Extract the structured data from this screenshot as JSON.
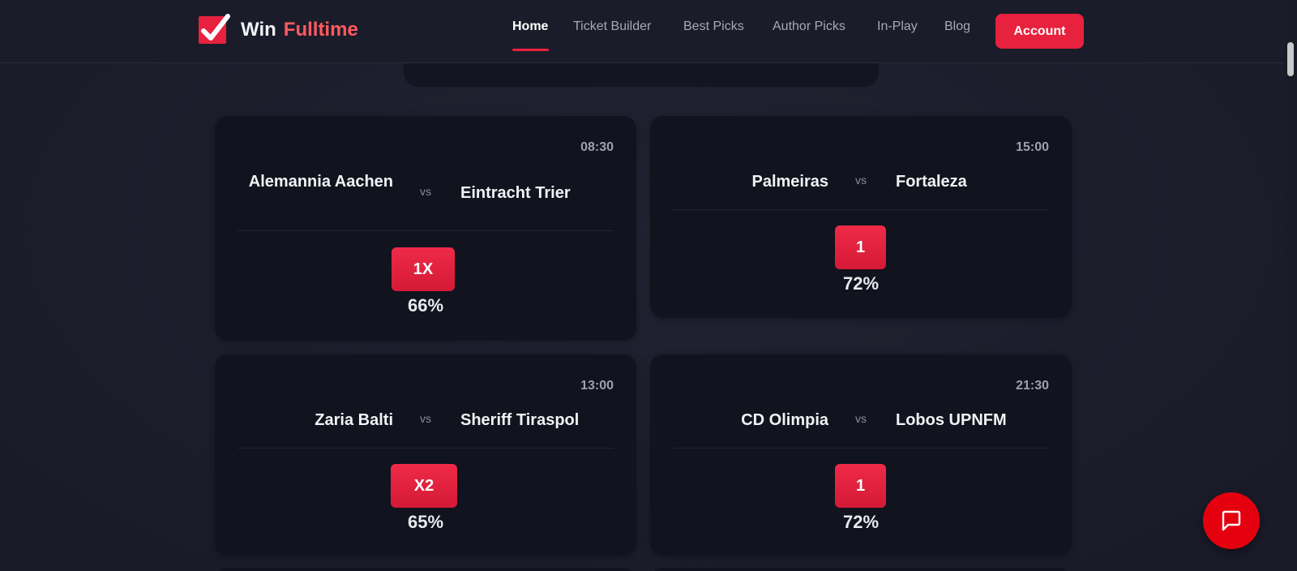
{
  "brand": {
    "word1": "Win",
    "word2": "Fulltime"
  },
  "nav": {
    "items": [
      {
        "label": "Home",
        "active": true
      },
      {
        "label": "Ticket Builder",
        "active": false
      },
      {
        "label": "Best Picks",
        "active": false
      },
      {
        "label": "Author Picks",
        "active": false
      },
      {
        "label": "In-Play",
        "active": false
      },
      {
        "label": "Blog",
        "active": false
      }
    ],
    "account_label": "Account"
  },
  "matches": [
    {
      "time": "08:30",
      "home": "Alemannia Aachen",
      "away": "Eintracht Trier",
      "vs": "vs",
      "pick": "1X",
      "probability": "66%"
    },
    {
      "time": "15:00",
      "home": "Palmeiras",
      "away": "Fortaleza",
      "vs": "vs",
      "pick": "1",
      "probability": "72%"
    },
    {
      "time": "13:00",
      "home": "Zaria Balti",
      "away": "Sheriff Tiraspol",
      "vs": "vs",
      "pick": "X2",
      "probability": "65%"
    },
    {
      "time": "21:30",
      "home": "CD Olimpia",
      "away": "Lobos UPNFM",
      "vs": "vs",
      "pick": "1",
      "probability": "72%"
    }
  ],
  "colors": {
    "accent": "#e8213f",
    "accent_text": "#ff5a5f",
    "background": "#1e1f2e",
    "card": "#11131e",
    "chat_button": "#e5000f"
  },
  "icons": {
    "logo": "checkmark-icon",
    "chat": "chat-bubble-icon"
  }
}
